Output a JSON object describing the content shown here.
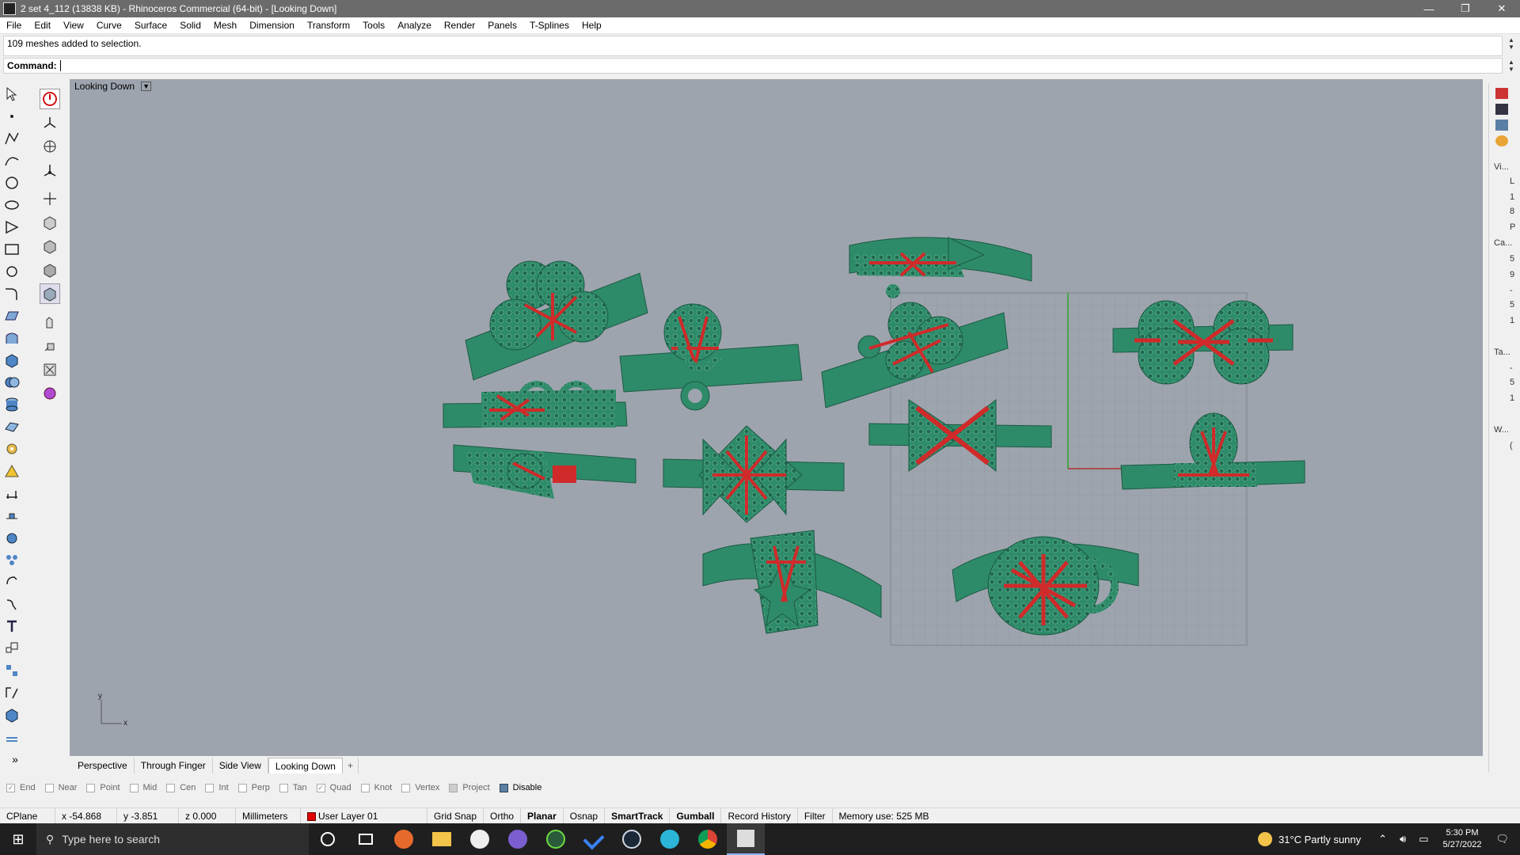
{
  "window": {
    "title": "2 set 4_112 (13838 KB) - Rhinoceros Commercial (64-bit) - [Looking Down]",
    "controls": [
      "—",
      "❐",
      "✕"
    ]
  },
  "menu": [
    "File",
    "Edit",
    "View",
    "Curve",
    "Surface",
    "Solid",
    "Mesh",
    "Dimension",
    "Transform",
    "Tools",
    "Analyze",
    "Render",
    "Panels",
    "T-Splines",
    "Help"
  ],
  "command": {
    "history": "109 meshes added to selection.",
    "label": "Command:",
    "value": ""
  },
  "viewport": {
    "name": "Looking Down",
    "axis_x": "x",
    "axis_y": "y",
    "bg_color": "#9ea4ad",
    "model_color": "#2e8b6a",
    "prong_color": "#d02a2a"
  },
  "viewport_tabs": [
    "Perspective",
    "Through Finger",
    "Side View",
    "Looking Down",
    "+"
  ],
  "osnaps": [
    {
      "label": "End",
      "checked": true
    },
    {
      "label": "Near",
      "checked": false
    },
    {
      "label": "Point",
      "checked": false
    },
    {
      "label": "Mid",
      "checked": false
    },
    {
      "label": "Cen",
      "checked": false
    },
    {
      "label": "Int",
      "checked": false
    },
    {
      "label": "Perp",
      "checked": false
    },
    {
      "label": "Tan",
      "checked": false
    },
    {
      "label": "Quad",
      "checked": true
    },
    {
      "label": "Knot",
      "checked": false
    },
    {
      "label": "Vertex",
      "checked": false
    },
    {
      "label": "Project",
      "checked": false
    },
    {
      "label": "Disable",
      "checked": false
    }
  ],
  "status": {
    "cplane": "CPlane",
    "x": "x -54.868",
    "y": "y -3.851",
    "z": "z 0.000",
    "units": "Millimeters",
    "layer": "User Layer 01",
    "grid_snap": "Grid Snap",
    "ortho": "Ortho",
    "planar": "Planar",
    "osnap": "Osnap",
    "smarttrack": "SmartTrack",
    "gumball": "Gumball",
    "record_history": "Record History",
    "filter": "Filter",
    "memory": "Memory use: 525 MB"
  },
  "right_panel": [
    "Vi...",
    "L",
    "1",
    "8",
    "P",
    "Ca...",
    "5",
    "9",
    "-",
    "5",
    "1",
    "Ta...",
    "-",
    "5",
    "1",
    "W...",
    "("
  ],
  "taskbar": {
    "search_placeholder": "Type here to search",
    "weather": "31°C  Partly sunny",
    "time": "5:30 PM",
    "date": "5/27/2022"
  }
}
